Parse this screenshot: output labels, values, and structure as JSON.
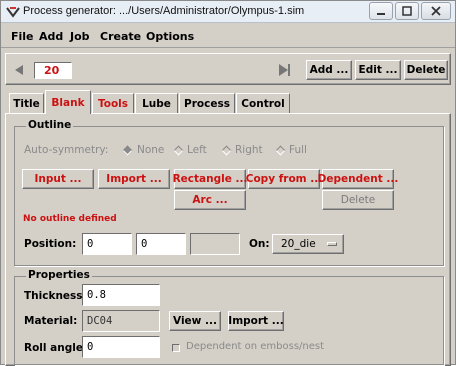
{
  "window": {
    "title": "Process generator: .../Users/Administrator/Olympus-1.sim",
    "app_icon": "process-generator-icon",
    "controls": [
      "minimize-icon",
      "maximize-icon",
      "close-icon"
    ]
  },
  "menu": [
    "File",
    "Add",
    "Job",
    "Create",
    "Options"
  ],
  "toolbar": {
    "record_number": "20",
    "prev_icon": "triangle-left-icon",
    "next_icon": "triangle-right-icon",
    "add_label": "Add ...",
    "edit_label": "Edit ...",
    "delete_label": "Delete"
  },
  "tabs": [
    {
      "label": "Title"
    },
    {
      "label": "Blank"
    },
    {
      "label": "Tools"
    },
    {
      "label": "Lube"
    },
    {
      "label": "Process"
    },
    {
      "label": "Control"
    }
  ],
  "active_tab": "Blank",
  "outline": {
    "title": "Outline",
    "autosym_label": "Auto-symmetry:",
    "autosym_options": [
      "None",
      "Left",
      "Right",
      "Full"
    ],
    "autosym_selected": "None",
    "buttons_row1": [
      "Input ...",
      "Import ...",
      "Rectangle ...",
      "Copy from ...",
      "Dependent ..."
    ],
    "arc_label": "Arc ...",
    "delete_label": "Delete",
    "error_message": "No outline defined",
    "position_label": "Position:",
    "position_x": "0",
    "position_y": "0",
    "position_z": "",
    "on_label": "On:",
    "on_value": "20_die"
  },
  "properties": {
    "title": "Properties",
    "thickness_label": "Thickness:",
    "thickness_value": "0.8",
    "material_label": "Material:",
    "material_value": "DC04",
    "view_label": "View ...",
    "import_label": "Import ...",
    "roll_angle_label": "Roll angle:",
    "roll_angle_value": "0",
    "dependent_label": "Dependent on emboss/nest"
  },
  "colors": {
    "accent_red": "#cc1111",
    "panel": "#d4d0c8"
  }
}
